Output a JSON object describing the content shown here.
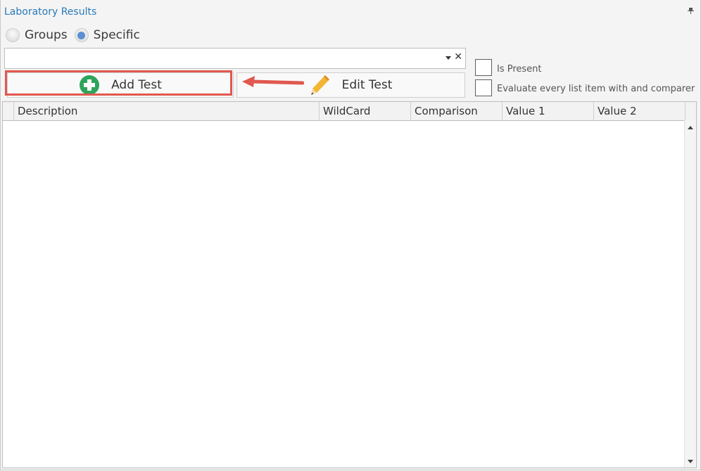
{
  "panel": {
    "title": "Laboratory Results"
  },
  "mode": {
    "options": [
      {
        "label": "Groups",
        "selected": false
      },
      {
        "label": "Specific",
        "selected": true
      }
    ]
  },
  "selector": {
    "value": ""
  },
  "toolbar": {
    "add_label": "Add Test",
    "edit_label": "Edit Test"
  },
  "options": {
    "is_present": {
      "label": "Is Present",
      "checked": false
    },
    "evaluate_every": {
      "label": "Evaluate every list item with and comparer",
      "checked": false
    }
  },
  "grid": {
    "columns": [
      "Description",
      "WildCard",
      "Comparison",
      "Value 1",
      "Value 2"
    ],
    "rows": []
  },
  "colors": {
    "accent": "#2a7ab8",
    "highlight": "#e0584f",
    "add_icon": "#2ea45a",
    "edit_icon": "#f2b632"
  }
}
